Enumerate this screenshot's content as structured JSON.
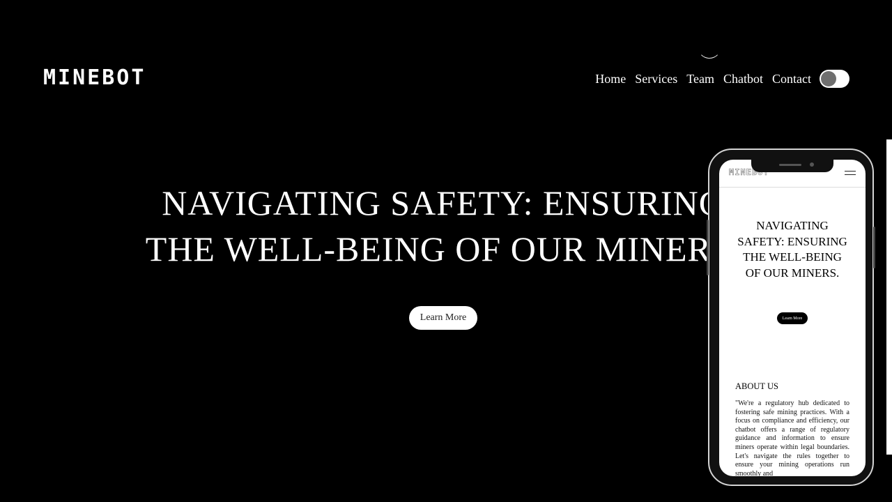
{
  "header": {
    "logo": "MINEBOT",
    "nav": [
      "Home",
      "Services",
      "Team",
      "Chatbot",
      "Contact"
    ],
    "theme_toggle": "dark-mode-toggle"
  },
  "hero": {
    "title_line1": "NAVIGATING SAFETY: ENSURING",
    "title_line2": "THE WELL-BEING OF OUR MINERS.",
    "button": "Learn More"
  },
  "mobile_preview": {
    "logo": "MINEBOT",
    "menu_icon": "hamburger-icon",
    "hero_title": "NAVIGATING SAFETY: ENSURING THE WELL-BEING OF OUR MINERS.",
    "button": "Learn More",
    "about_title": "ABOUT US",
    "about_text": "\"We're a regulatory hub dedicated to fostering safe mining practices. With a focus on compliance and efficiency, our chatbot offers a range of regulatory guidance and information to ensure miners operate within legal boundaries. Let's navigate the rules together to ensure your mining operations run smoothly and"
  },
  "colors": {
    "background": "#000000",
    "text": "#ffffff",
    "toggle_knob": "#6f6f6f"
  }
}
